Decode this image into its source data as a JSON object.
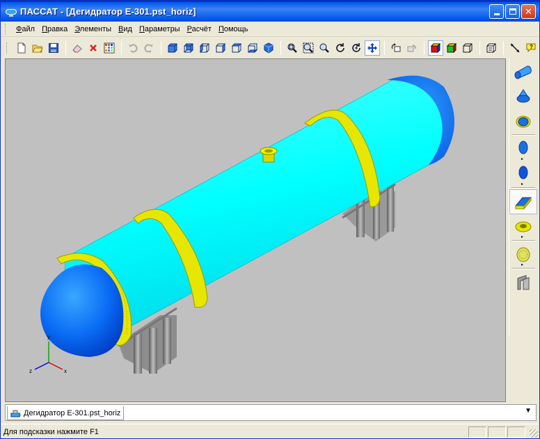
{
  "window": {
    "title": "ПАССАТ - [Дегидратор Е-301.pst_horiz]"
  },
  "menu": {
    "items": [
      "Файл",
      "Правка",
      "Элементы",
      "Вид",
      "Параметры",
      "Расчёт",
      "Помощь"
    ]
  },
  "toolbar": {
    "groups": [
      [
        "new-file-icon",
        "open-folder-icon",
        "save-icon"
      ],
      [
        "eraser-icon",
        "delete-icon",
        "grid-icon"
      ],
      [
        "undo-icon",
        "redo-icon"
      ],
      [
        "view-front-icon",
        "view-back-icon",
        "view-left-icon",
        "view-right-icon",
        "view-top-icon",
        "view-bottom-icon",
        "view-iso-icon"
      ],
      [
        "zoom-window-icon",
        "zoom-area-icon",
        "zoom-icon",
        "rotate-icon",
        "rotate-axis-icon",
        "pan-icon"
      ],
      [
        "rotate-view-icon",
        "flip-icon"
      ],
      [
        "solid-shading-icon",
        "color-shading-icon",
        "wireframe-icon"
      ],
      [
        "properties-icon"
      ],
      [
        "dimension-icon",
        "hint-icon"
      ]
    ]
  },
  "palette": {
    "items": [
      "cylinder-shell-icon",
      "cone-shell-icon",
      "shell-with-ring-icon",
      "elliptic-head-icon",
      "flat-head-icon",
      "ring-stiffener-icon",
      "nozzle-flange-icon",
      "flange-icon",
      "saddle-support-icon"
    ]
  },
  "tabs": {
    "active": "Дегидратор Е-301.pst_horiz"
  },
  "status": {
    "hint": "Для подсказки нажмите F1"
  },
  "axes": {
    "x": "x",
    "y": "y",
    "z": "z"
  },
  "colors": {
    "shell": "#00ffff",
    "head": "#0066ff",
    "ring": "#e0e000",
    "support": "#888888",
    "viewport_bg": "#c0c0c0"
  }
}
